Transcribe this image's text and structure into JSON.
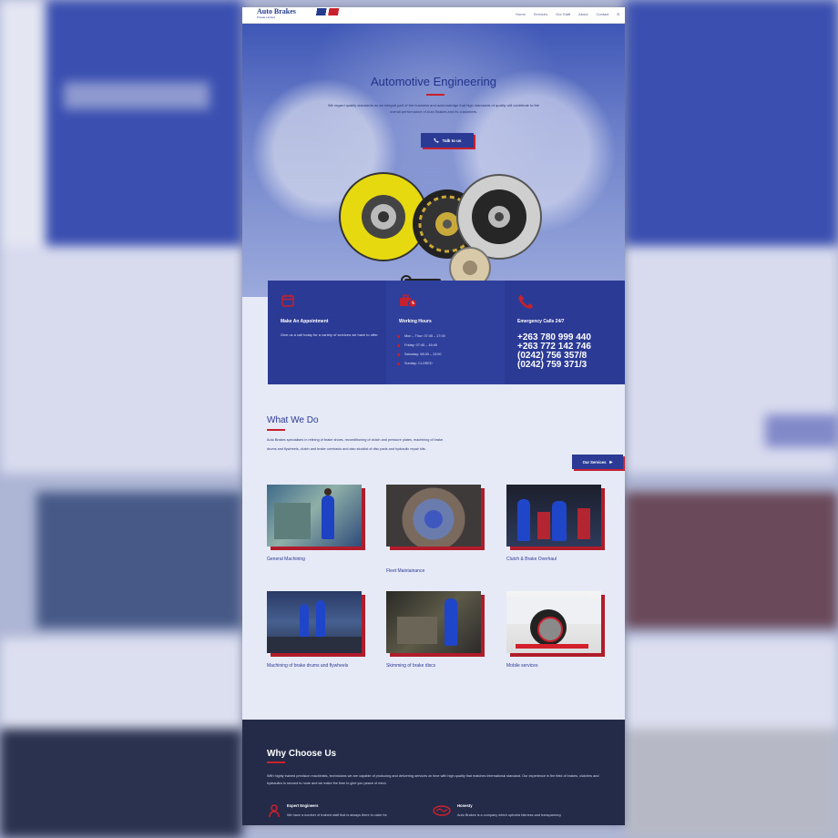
{
  "brand": {
    "name": "Auto Brakes",
    "tagline": "Private Limited"
  },
  "nav": {
    "items": [
      "Home",
      "Services",
      "Our Staff",
      "About",
      "Contact",
      "B"
    ]
  },
  "hero": {
    "title": "Automotive Engineering",
    "lead": "We regard quality standards as an integral part of the business and acknowledge that high standards of quality will contribute to the overall performance of Auto Brakes and its customers.",
    "cta": "Talk to us"
  },
  "info": {
    "appointment": {
      "title": "Make An Appointment",
      "text": "Give us a call today for a variety of services we have to offer."
    },
    "hours": {
      "title": "Working Hours",
      "items": [
        "Mon – Thur: 07:45 – 17:00",
        "Friday: 07:45 – 16:45",
        "Saturday: 08:00 – 13:00",
        "Sunday: CLOSED"
      ]
    },
    "emergency": {
      "title": "Emergency Calls 24/7",
      "phones": [
        "+263 780 999 440",
        "+263 772 142 746",
        "(0242) 756 357/8",
        "(0242) 759 371/3"
      ]
    }
  },
  "what": {
    "title": "What We Do",
    "text": "Auto Brakes specialises in relining of brake shoes, reconditioning of clutch and pressure plates, machining of brake drums and flywheels, clutch and brake overhauls and also stockist of disc pads and hydraulic repair kits.",
    "button": "Our Services",
    "services": [
      "General Machining",
      "Fleet Maintainance",
      "Clutch & Brake Overhaul",
      "Machining of brake drums and flywheels",
      "Skimming of brake discs",
      "Mobile services"
    ]
  },
  "why": {
    "title": "Why Choose Us",
    "text": "With highly trained precision machinists, technicians we are capable of producing and delivering services on time with high quality that matches international standard. Our experience in the field of brakes, clutches and hydraulics is second to none and we make the time to give you peace of mind.",
    "features": [
      {
        "title": "Expert Engineers",
        "text": "We have a number of trained staff that is always there to cater for"
      },
      {
        "title": "Honesty",
        "text": "Auto Brakes is a company which upholds fairness and transparency"
      }
    ]
  },
  "colors": {
    "primary": "#2b3b95",
    "accent": "#c8202c",
    "dark": "#232b48"
  }
}
